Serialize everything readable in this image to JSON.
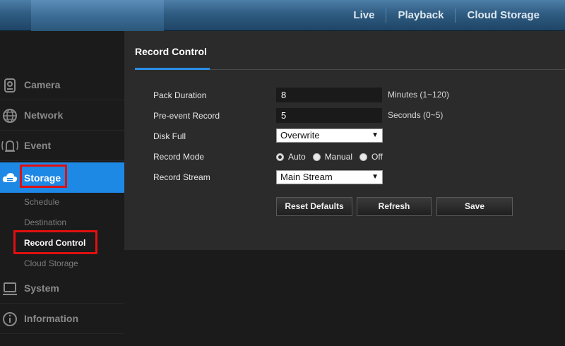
{
  "topnav": {
    "items": [
      "Live",
      "Playback",
      "Cloud Storage"
    ]
  },
  "sidebar": {
    "items": [
      {
        "label": "Camera",
        "icon": "camera-icon"
      },
      {
        "label": "Network",
        "icon": "network-icon"
      },
      {
        "label": "Event",
        "icon": "event-icon"
      },
      {
        "label": "Storage",
        "icon": "storage-icon"
      },
      {
        "label": "System",
        "icon": "system-icon"
      },
      {
        "label": "Information",
        "icon": "information-icon"
      }
    ],
    "storage_subitems": [
      "Schedule",
      "Destination",
      "Record Control",
      "Cloud Storage"
    ]
  },
  "panel": {
    "title": "Record Control",
    "fields": {
      "pack_duration": {
        "label": "Pack Duration",
        "value": "8",
        "hint": "Minutes  (1~120)"
      },
      "pre_event": {
        "label": "Pre-event Record",
        "value": "5",
        "hint": "Seconds  (0~5)"
      },
      "disk_full": {
        "label": "Disk Full",
        "value": "Overwrite"
      },
      "record_mode": {
        "label": "Record Mode",
        "options": [
          "Auto",
          "Manual",
          "Off"
        ],
        "selected": "Auto"
      },
      "record_stream": {
        "label": "Record Stream",
        "value": "Main Stream"
      }
    },
    "buttons": {
      "reset": "Reset Defaults",
      "refresh": "Refresh",
      "save": "Save"
    }
  },
  "colors": {
    "accent": "#1e88e5",
    "highlight": "#e01010"
  }
}
